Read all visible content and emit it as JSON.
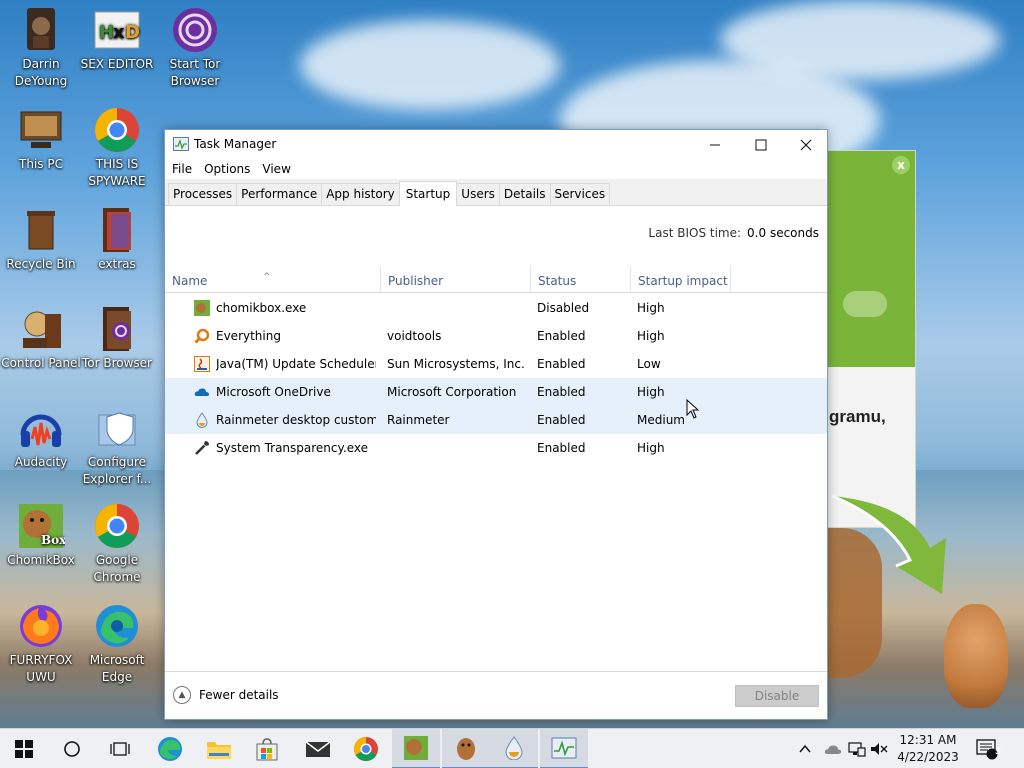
{
  "desktop": {
    "icons": [
      {
        "label": "Darrin DeYoung"
      },
      {
        "label": "SEX EDITOR"
      },
      {
        "label": "Start Tor Browser"
      },
      {
        "label": "This PC"
      },
      {
        "label": "THIS IS SPYWARE"
      },
      {
        "label": "Recycle Bin"
      },
      {
        "label": "extras"
      },
      {
        "label": "Control Panel"
      },
      {
        "label": "Tor Browser"
      },
      {
        "label": "Audacity"
      },
      {
        "label": "Configure Explorer f..."
      },
      {
        "label": "ChomikBox"
      },
      {
        "label": "Google Chrome"
      },
      {
        "label": "FURRYFOX UWU"
      },
      {
        "label": "Microsoft Edge"
      }
    ]
  },
  "popup": {
    "close_label": "x",
    "text": "gramu,",
    "colors": {
      "header": "#7ab53a"
    }
  },
  "window": {
    "title": "Task Manager",
    "menu": [
      "File",
      "Options",
      "View"
    ],
    "tabs": [
      "Processes",
      "Performance",
      "App history",
      "Startup",
      "Users",
      "Details",
      "Services"
    ],
    "active_tab": "Startup",
    "bios_label": "Last BIOS time:",
    "bios_value": "0.0 seconds",
    "columns": [
      "Name",
      "Publisher",
      "Status",
      "Startup impact"
    ],
    "rows": [
      {
        "icon": "chomikbox-icon",
        "name": "chomikbox.exe",
        "publisher": "",
        "status": "Disabled",
        "impact": "High"
      },
      {
        "icon": "everything-search-icon",
        "name": "Everything",
        "publisher": "voidtools",
        "status": "Enabled",
        "impact": "High"
      },
      {
        "icon": "java-icon",
        "name": "Java(TM) Update Scheduler",
        "publisher": "Sun Microsystems, Inc.",
        "status": "Enabled",
        "impact": "Low"
      },
      {
        "icon": "onedrive-cloud-icon",
        "name": "Microsoft OneDrive",
        "publisher": "Microsoft Corporation",
        "status": "Enabled",
        "impact": "High"
      },
      {
        "icon": "rainmeter-drop-icon",
        "name": "Rainmeter desktop customi...",
        "publisher": "Rainmeter",
        "status": "Enabled",
        "impact": "Medium"
      },
      {
        "icon": "wrench-icon",
        "name": "System Transparency.exe",
        "publisher": "",
        "status": "Enabled",
        "impact": "High"
      }
    ],
    "fewer_details": "Fewer details",
    "disable_button": "Disable"
  },
  "taskbar": {
    "time": "12:31 AM",
    "date": "4/22/2023",
    "notification_count": "3",
    "accent": "#6a8bbf"
  }
}
